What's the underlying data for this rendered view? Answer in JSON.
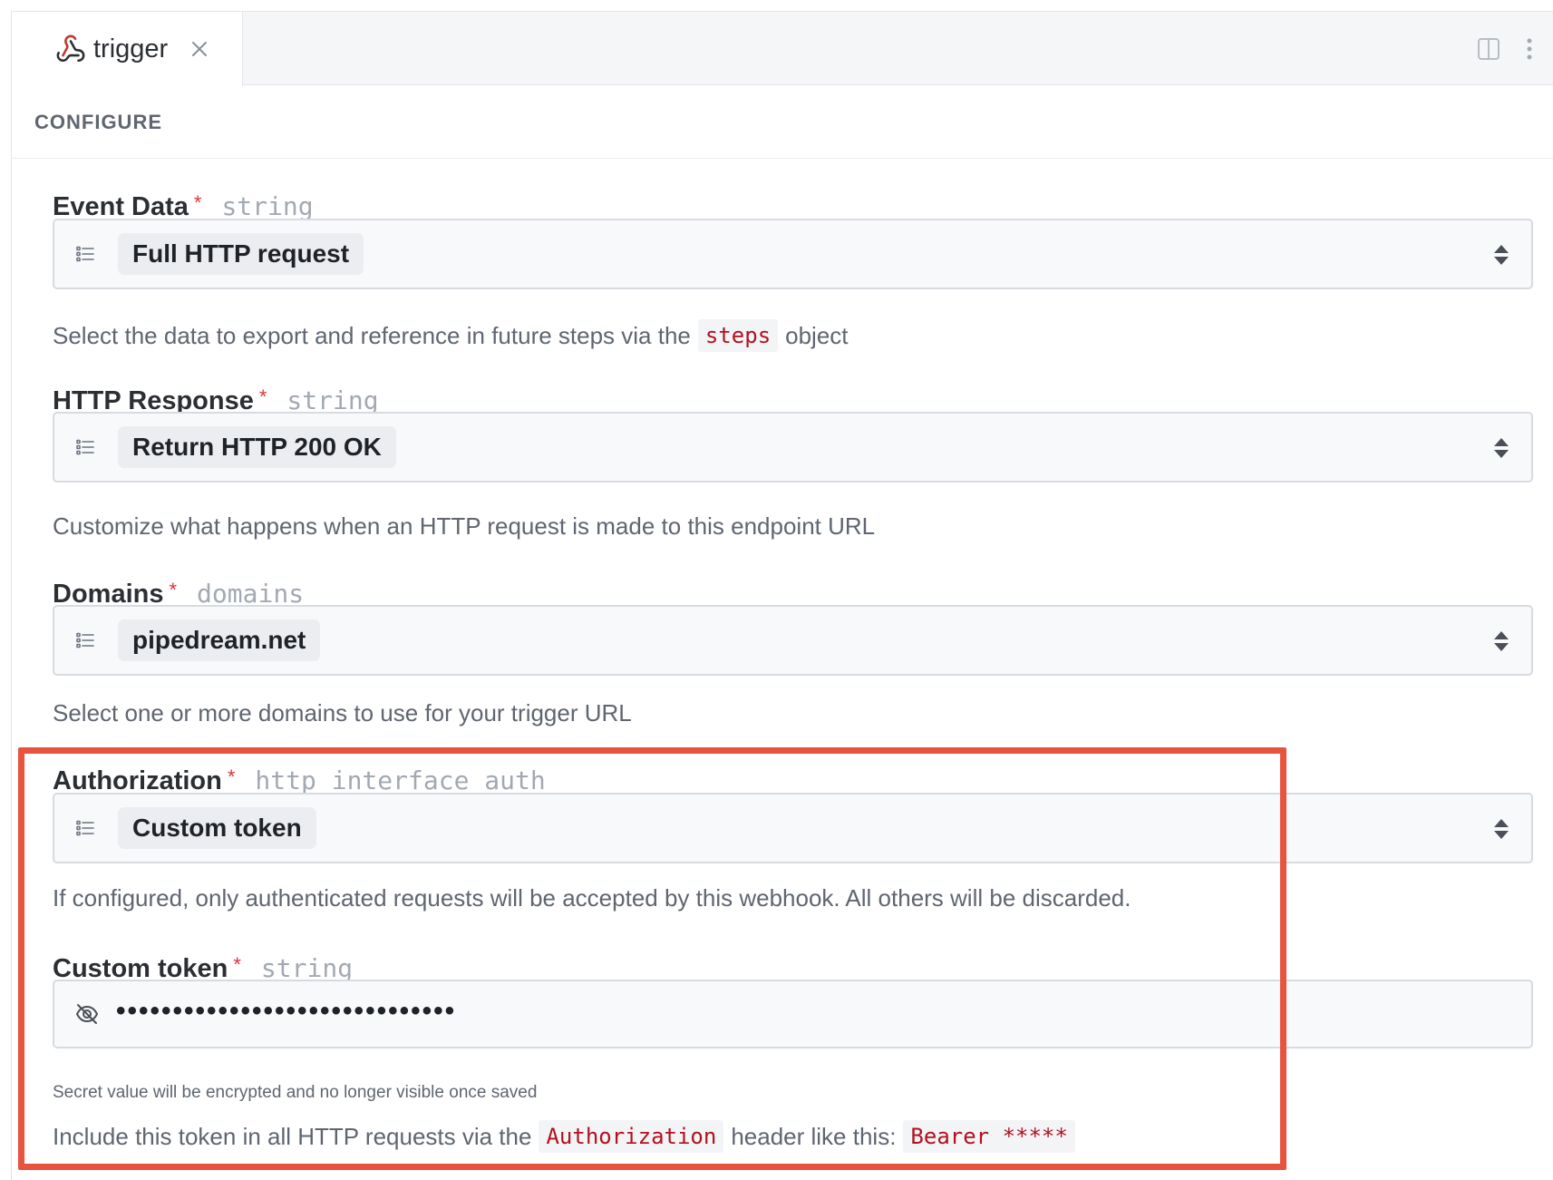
{
  "tabs": [
    {
      "label": "trigger",
      "icon": "webhook-icon",
      "active": true
    }
  ],
  "section": {
    "title": "CONFIGURE"
  },
  "fields": {
    "event_data": {
      "label": "Event Data",
      "required_mark": "*",
      "type": "string",
      "value": "Full HTTP request",
      "help_before": "Select the data to export and reference in future steps via the",
      "help_code": "steps",
      "help_after": "object"
    },
    "http_response": {
      "label": "HTTP Response",
      "required_mark": "*",
      "type": "string",
      "value": "Return HTTP 200 OK",
      "help": "Customize what happens when an HTTP request is made to this endpoint URL"
    },
    "domains": {
      "label": "Domains",
      "required_mark": "*",
      "type": "domains",
      "value": "pipedream.net",
      "help": "Select one or more domains to use for your trigger URL"
    },
    "authorization": {
      "label": "Authorization",
      "required_mark": "*",
      "type": "http_interface_auth",
      "value": "Custom token",
      "help": "If configured, only authenticated requests will be accepted by this webhook. All others will be discarded."
    },
    "custom_token": {
      "label": "Custom token",
      "required_mark": "*",
      "type": "string",
      "masked_value": "••••••••••••••••••••••••••••••",
      "secret_note": "Secret value will be encrypted and no longer visible once saved",
      "help_before": "Include this token in all HTTP requests via the",
      "help_code_1": "Authorization",
      "help_middle": "header like this:",
      "help_code_2": "Bearer *****"
    }
  },
  "colors": {
    "highlight": "#e8533f",
    "required": "#e0333a",
    "code_text": "#b3101f"
  }
}
